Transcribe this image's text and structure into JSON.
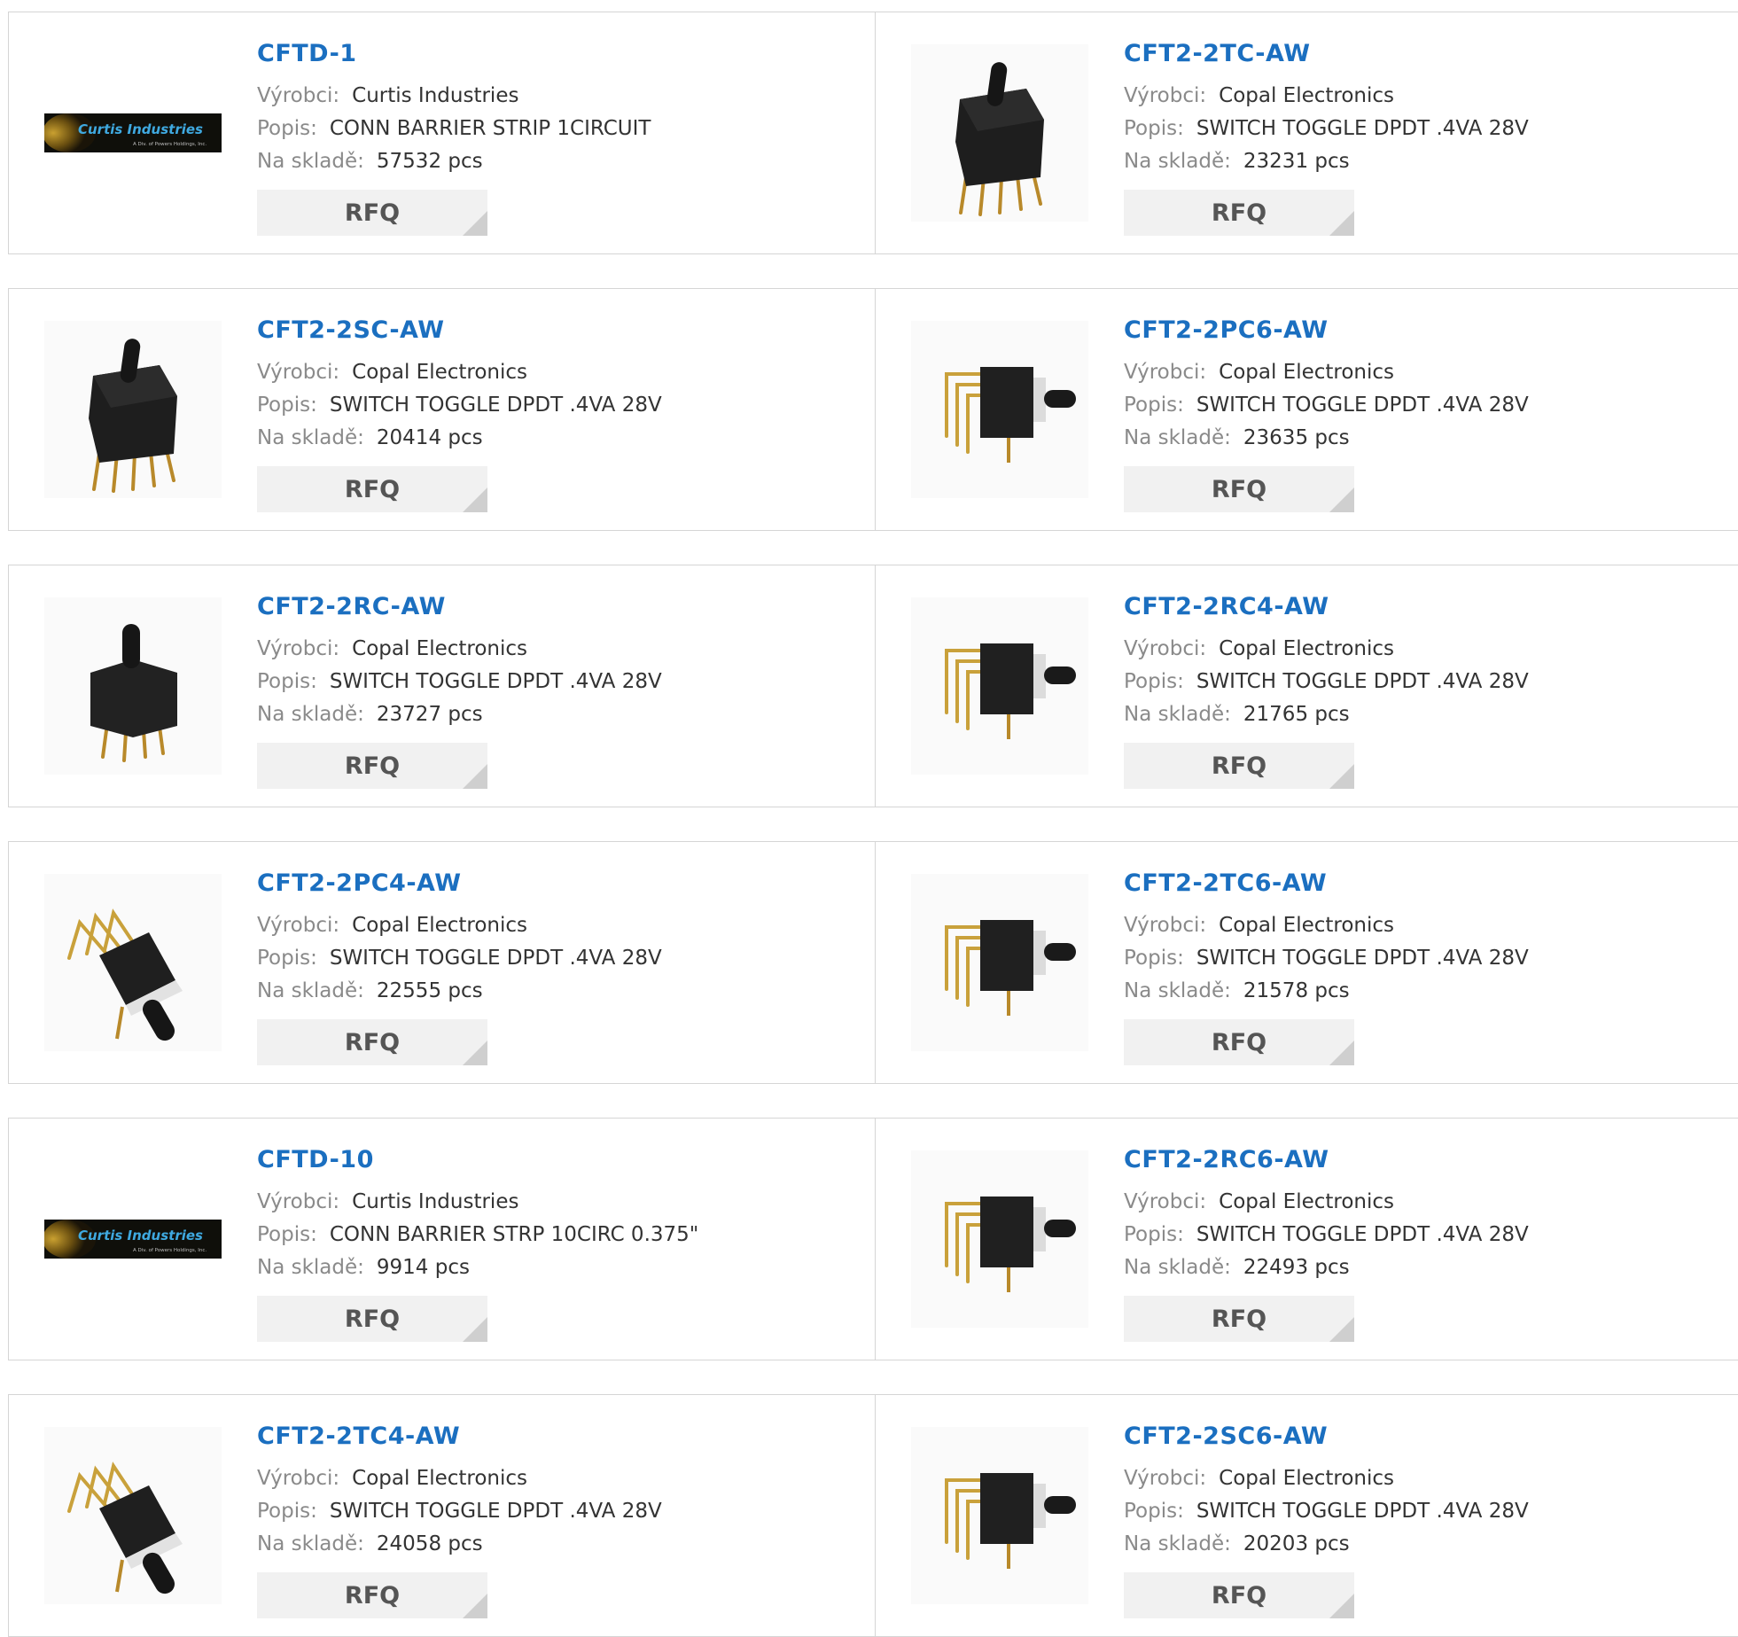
{
  "labels": {
    "manufacturer": "Výrobci:",
    "description": "Popis:",
    "stock": "Na skladě:",
    "rfq": "RFQ"
  },
  "colors": {
    "part_link": "#1b6fc0",
    "label_grey": "#8a8a8a",
    "button_bg": "#f1f1f1",
    "border": "#d5d5d5"
  },
  "products": [
    {
      "part": "CFTD-1",
      "manufacturer": "Curtis Industries",
      "description": "CONN BARRIER STRIP 1CIRCUIT",
      "stock": "57532 pcs",
      "image": "curtis-logo"
    },
    {
      "part": "CFT2-2TC-AW",
      "manufacturer": "Copal Electronics",
      "description": "SWITCH TOGGLE DPDT .4VA 28V",
      "stock": "23231 pcs",
      "image": "toggle-vertical"
    },
    {
      "part": "CFT2-2SC-AW",
      "manufacturer": "Copal Electronics",
      "description": "SWITCH TOGGLE DPDT .4VA 28V",
      "stock": "20414 pcs",
      "image": "toggle-vertical"
    },
    {
      "part": "CFT2-2PC6-AW",
      "manufacturer": "Copal Electronics",
      "description": "SWITCH TOGGLE DPDT .4VA 28V",
      "stock": "23635 pcs",
      "image": "toggle-right-angle"
    },
    {
      "part": "CFT2-2RC-AW",
      "manufacturer": "Copal Electronics",
      "description": "SWITCH TOGGLE DPDT .4VA 28V",
      "stock": "23727 pcs",
      "image": "toggle-vertical-short"
    },
    {
      "part": "CFT2-2RC4-AW",
      "manufacturer": "Copal Electronics",
      "description": "SWITCH TOGGLE DPDT .4VA 28V",
      "stock": "21765 pcs",
      "image": "toggle-right-angle"
    },
    {
      "part": "CFT2-2PC4-AW",
      "manufacturer": "Copal Electronics",
      "description": "SWITCH TOGGLE DPDT .4VA 28V",
      "stock": "22555 pcs",
      "image": "toggle-angled"
    },
    {
      "part": "CFT2-2TC6-AW",
      "manufacturer": "Copal Electronics",
      "description": "SWITCH TOGGLE DPDT .4VA 28V",
      "stock": "21578 pcs",
      "image": "toggle-right-angle"
    },
    {
      "part": "CFTD-10",
      "manufacturer": "Curtis Industries",
      "description": "CONN BARRIER STRP 10CIRC 0.375\"",
      "stock": "9914 pcs",
      "image": "curtis-logo"
    },
    {
      "part": "CFT2-2RC6-AW",
      "manufacturer": "Copal Electronics",
      "description": "SWITCH TOGGLE DPDT .4VA 28V",
      "stock": "22493 pcs",
      "image": "toggle-right-angle"
    },
    {
      "part": "CFT2-2TC4-AW",
      "manufacturer": "Copal Electronics",
      "description": "SWITCH TOGGLE DPDT .4VA 28V",
      "stock": "24058 pcs",
      "image": "toggle-angled"
    },
    {
      "part": "CFT2-2SC6-AW",
      "manufacturer": "Copal Electronics",
      "description": "SWITCH TOGGLE DPDT .4VA 28V",
      "stock": "20203 pcs",
      "image": "toggle-right-angle"
    }
  ],
  "brand_logo": {
    "name": "Curtis Industries",
    "tagline": "A Div. of Powers Holdings, Inc."
  }
}
